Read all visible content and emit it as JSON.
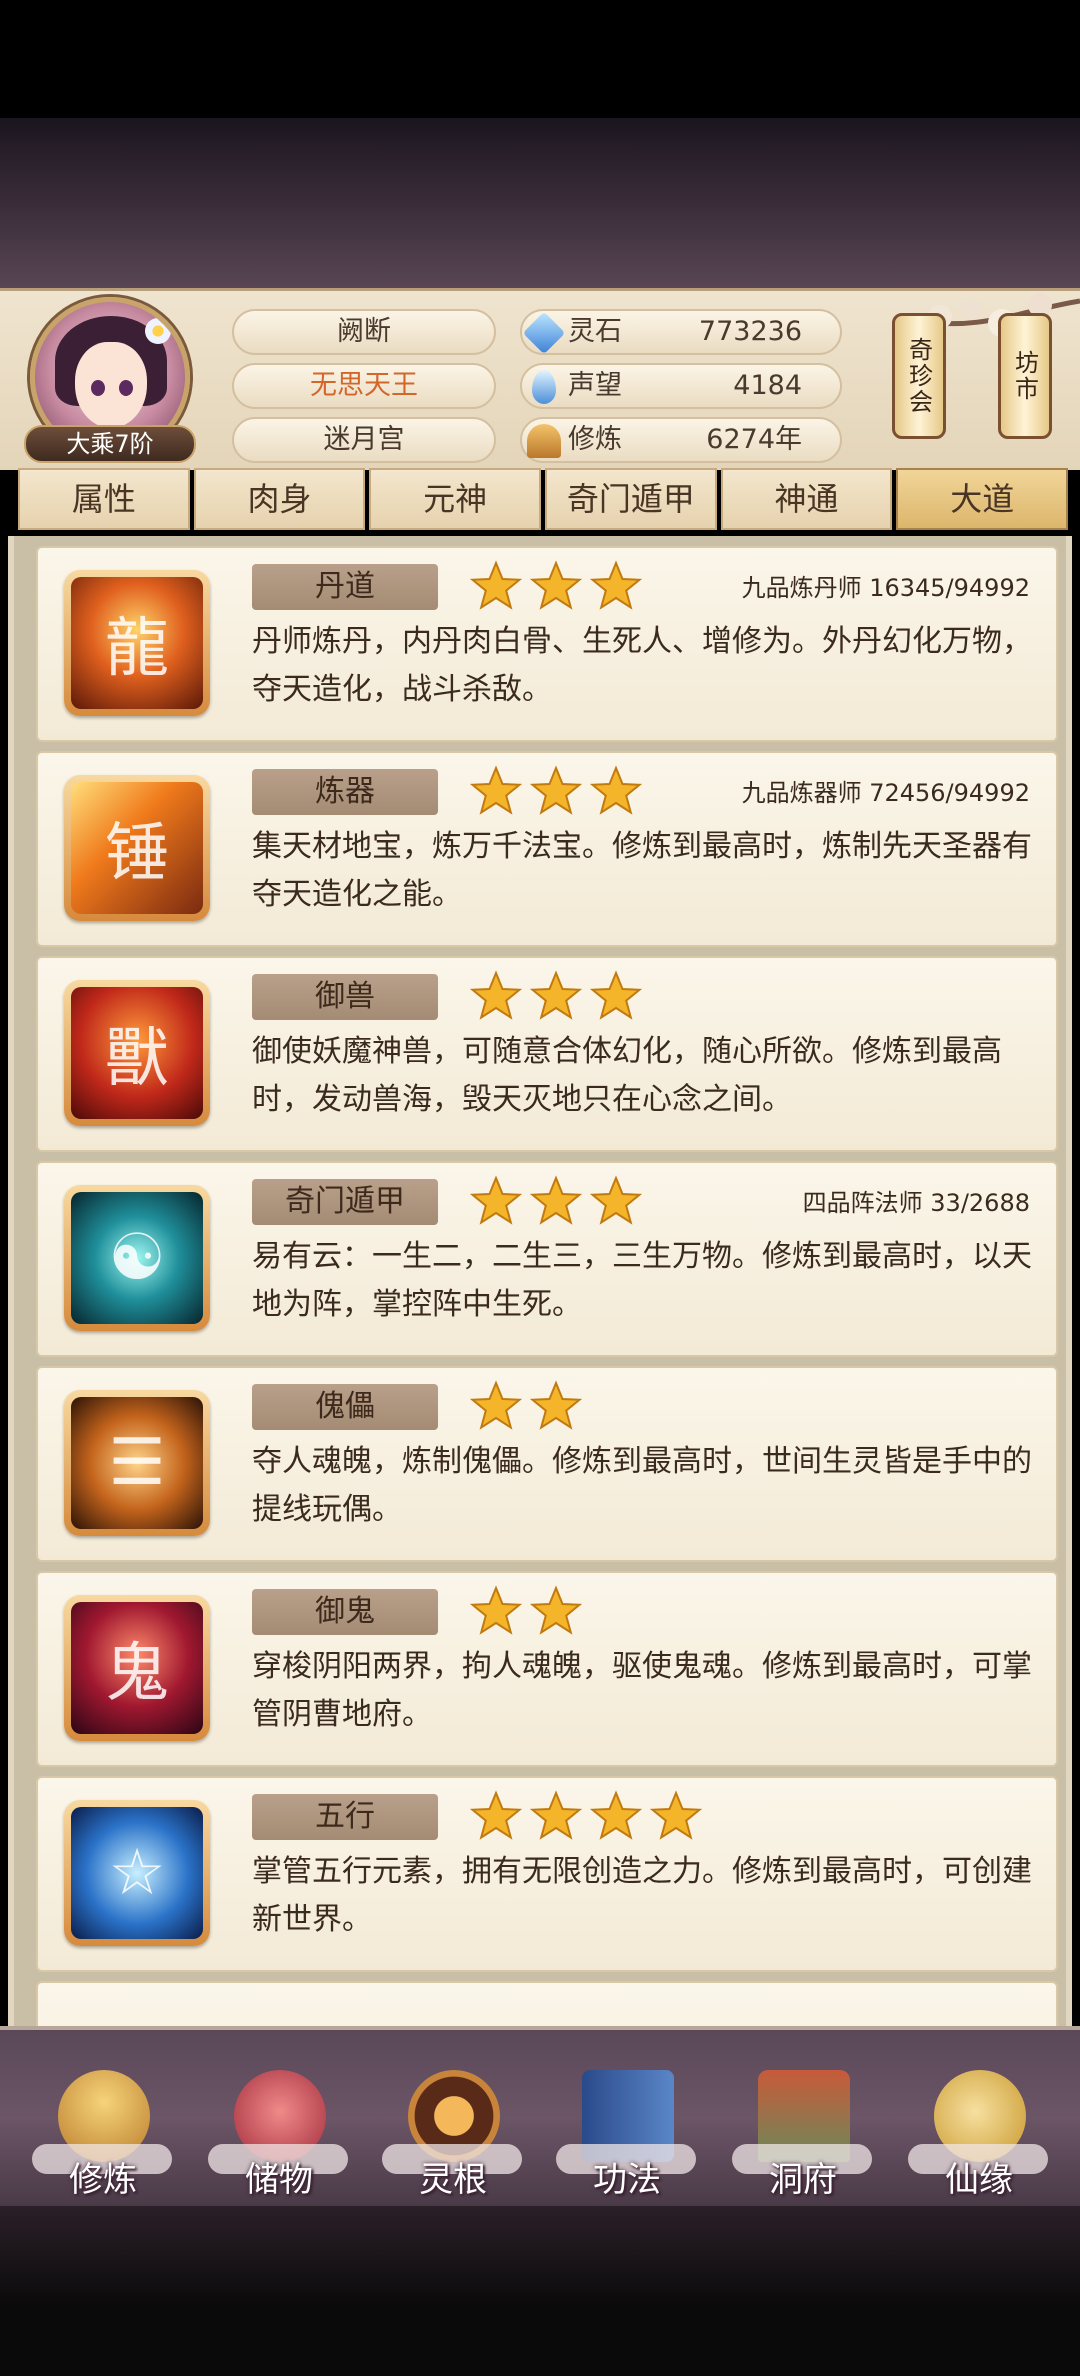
{
  "header": {
    "player_name": "阙断",
    "title": "无思天王",
    "sect": "迷月宫",
    "realm": "大乘7阶",
    "resources": [
      {
        "label": "灵石",
        "value": "773236",
        "icon": "spirit-stone-icon"
      },
      {
        "label": "声望",
        "value": "4184",
        "icon": "reputation-icon"
      },
      {
        "label": "修炼",
        "value": "6274年",
        "icon": "cultivation-icon"
      }
    ],
    "side_buttons": [
      "奇珍会",
      "坊市"
    ]
  },
  "tabs": [
    "属性",
    "肉身",
    "元神",
    "奇门遁甲",
    "神通",
    "大道"
  ],
  "active_tab": "大道",
  "skills": [
    {
      "name": "丹道",
      "stars": 3,
      "rank": "九品炼丹师 16345/94992",
      "desc": "丹师炼丹，内丹肉白骨、生死人、增修为。外丹幻化万物，夺天造化，战斗杀敌。"
    },
    {
      "name": "炼器",
      "stars": 3,
      "rank": "九品炼器师 72456/94992",
      "desc": "集天材地宝，炼万千法宝。修炼到最高时，炼制先天圣器有夺天造化之能。"
    },
    {
      "name": "御兽",
      "stars": 3,
      "rank": "",
      "desc": "御使妖魔神兽，可随意合体幻化，随心所欲。修炼到最高时，发动兽海，毁天灭地只在心念之间。"
    },
    {
      "name": "奇门遁甲",
      "stars": 3,
      "rank": "四品阵法师 33/2688",
      "desc": "易有云：一生二，二生三，三生万物。修炼到最高时，以天地为阵，掌控阵中生死。"
    },
    {
      "name": "傀儡",
      "stars": 2,
      "rank": "",
      "desc": "夺人魂魄，炼制傀儡。修炼到最高时，世间生灵皆是手中的提线玩偶。"
    },
    {
      "name": "御鬼",
      "stars": 2,
      "rank": "",
      "desc": "穿梭阴阳两界，拘人魂魄，驱使鬼魂。修炼到最高时，可掌管阴曹地府。"
    },
    {
      "name": "五行",
      "stars": 4,
      "rank": "",
      "desc": "掌管五行元素，拥有无限创造之力。修炼到最高时，可创建新世界。"
    }
  ],
  "nav": [
    "修炼",
    "储物",
    "灵根",
    "功法",
    "洞府",
    "仙缘"
  ],
  "colors": {
    "accent_orange": "#d4662a",
    "panel_beige": "#efe4cf",
    "tag_brown": "#a48b74",
    "star_gold": "#f5b52a"
  }
}
